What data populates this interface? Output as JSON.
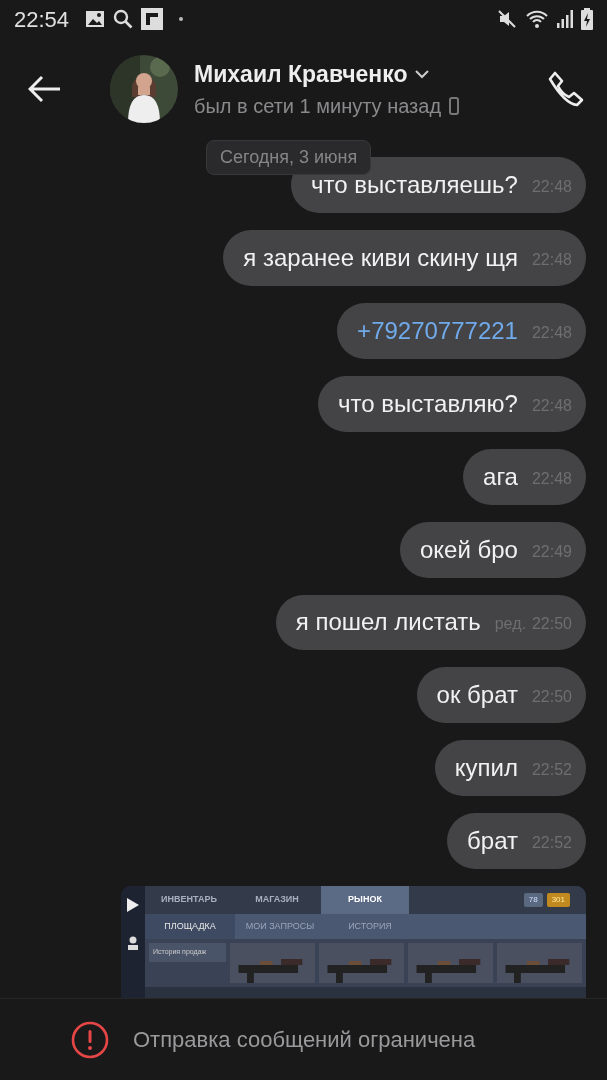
{
  "status_bar": {
    "time": "22:54"
  },
  "header": {
    "name": "Михаил Кравченко",
    "presence": "был в сети 1 минуту назад"
  },
  "date_divider": "Сегодня, 3 июня",
  "messages": [
    {
      "kind": "text",
      "text": "что выставляешь?",
      "time": "22:48"
    },
    {
      "kind": "text",
      "text": "я заранее киви скину щя",
      "time": "22:48"
    },
    {
      "kind": "link",
      "text": "+79270777221",
      "time": "22:48"
    },
    {
      "kind": "text",
      "text": "что выставляю?",
      "time": "22:48"
    },
    {
      "kind": "text",
      "text": "ага",
      "time": "22:48"
    },
    {
      "kind": "text",
      "text": "окей бро",
      "time": "22:49"
    },
    {
      "kind": "text",
      "text": "я пошел листать",
      "time": "22:50",
      "edited": "ред."
    },
    {
      "kind": "text",
      "text": "ок брат",
      "time": "22:50"
    },
    {
      "kind": "text",
      "text": "купил",
      "time": "22:52"
    },
    {
      "kind": "text",
      "text": "брат",
      "time": "22:52"
    },
    {
      "kind": "screenshot",
      "tabs": [
        {
          "label": "ИНВЕНТАРЬ",
          "selected": false
        },
        {
          "label": "МАГАЗИН",
          "selected": false
        },
        {
          "label": "РЫНОК",
          "selected": true
        }
      ],
      "currency": [
        "78",
        "301"
      ],
      "subtabs": [
        {
          "label": "ПЛОЩАДКА",
          "selected": true
        },
        {
          "label": "МОИ ЗАПРОСЫ",
          "selected": false
        },
        {
          "label": "ИСТОРИЯ",
          "selected": false
        }
      ],
      "sidebar": [
        "История продаж"
      ],
      "items": [
        {
          "kind": "picture"
        },
        {
          "kind": "picture"
        },
        {
          "kind": "picture"
        },
        {
          "kind": "picture"
        }
      ]
    }
  ],
  "notice": "Отправка сообщений ограничена"
}
